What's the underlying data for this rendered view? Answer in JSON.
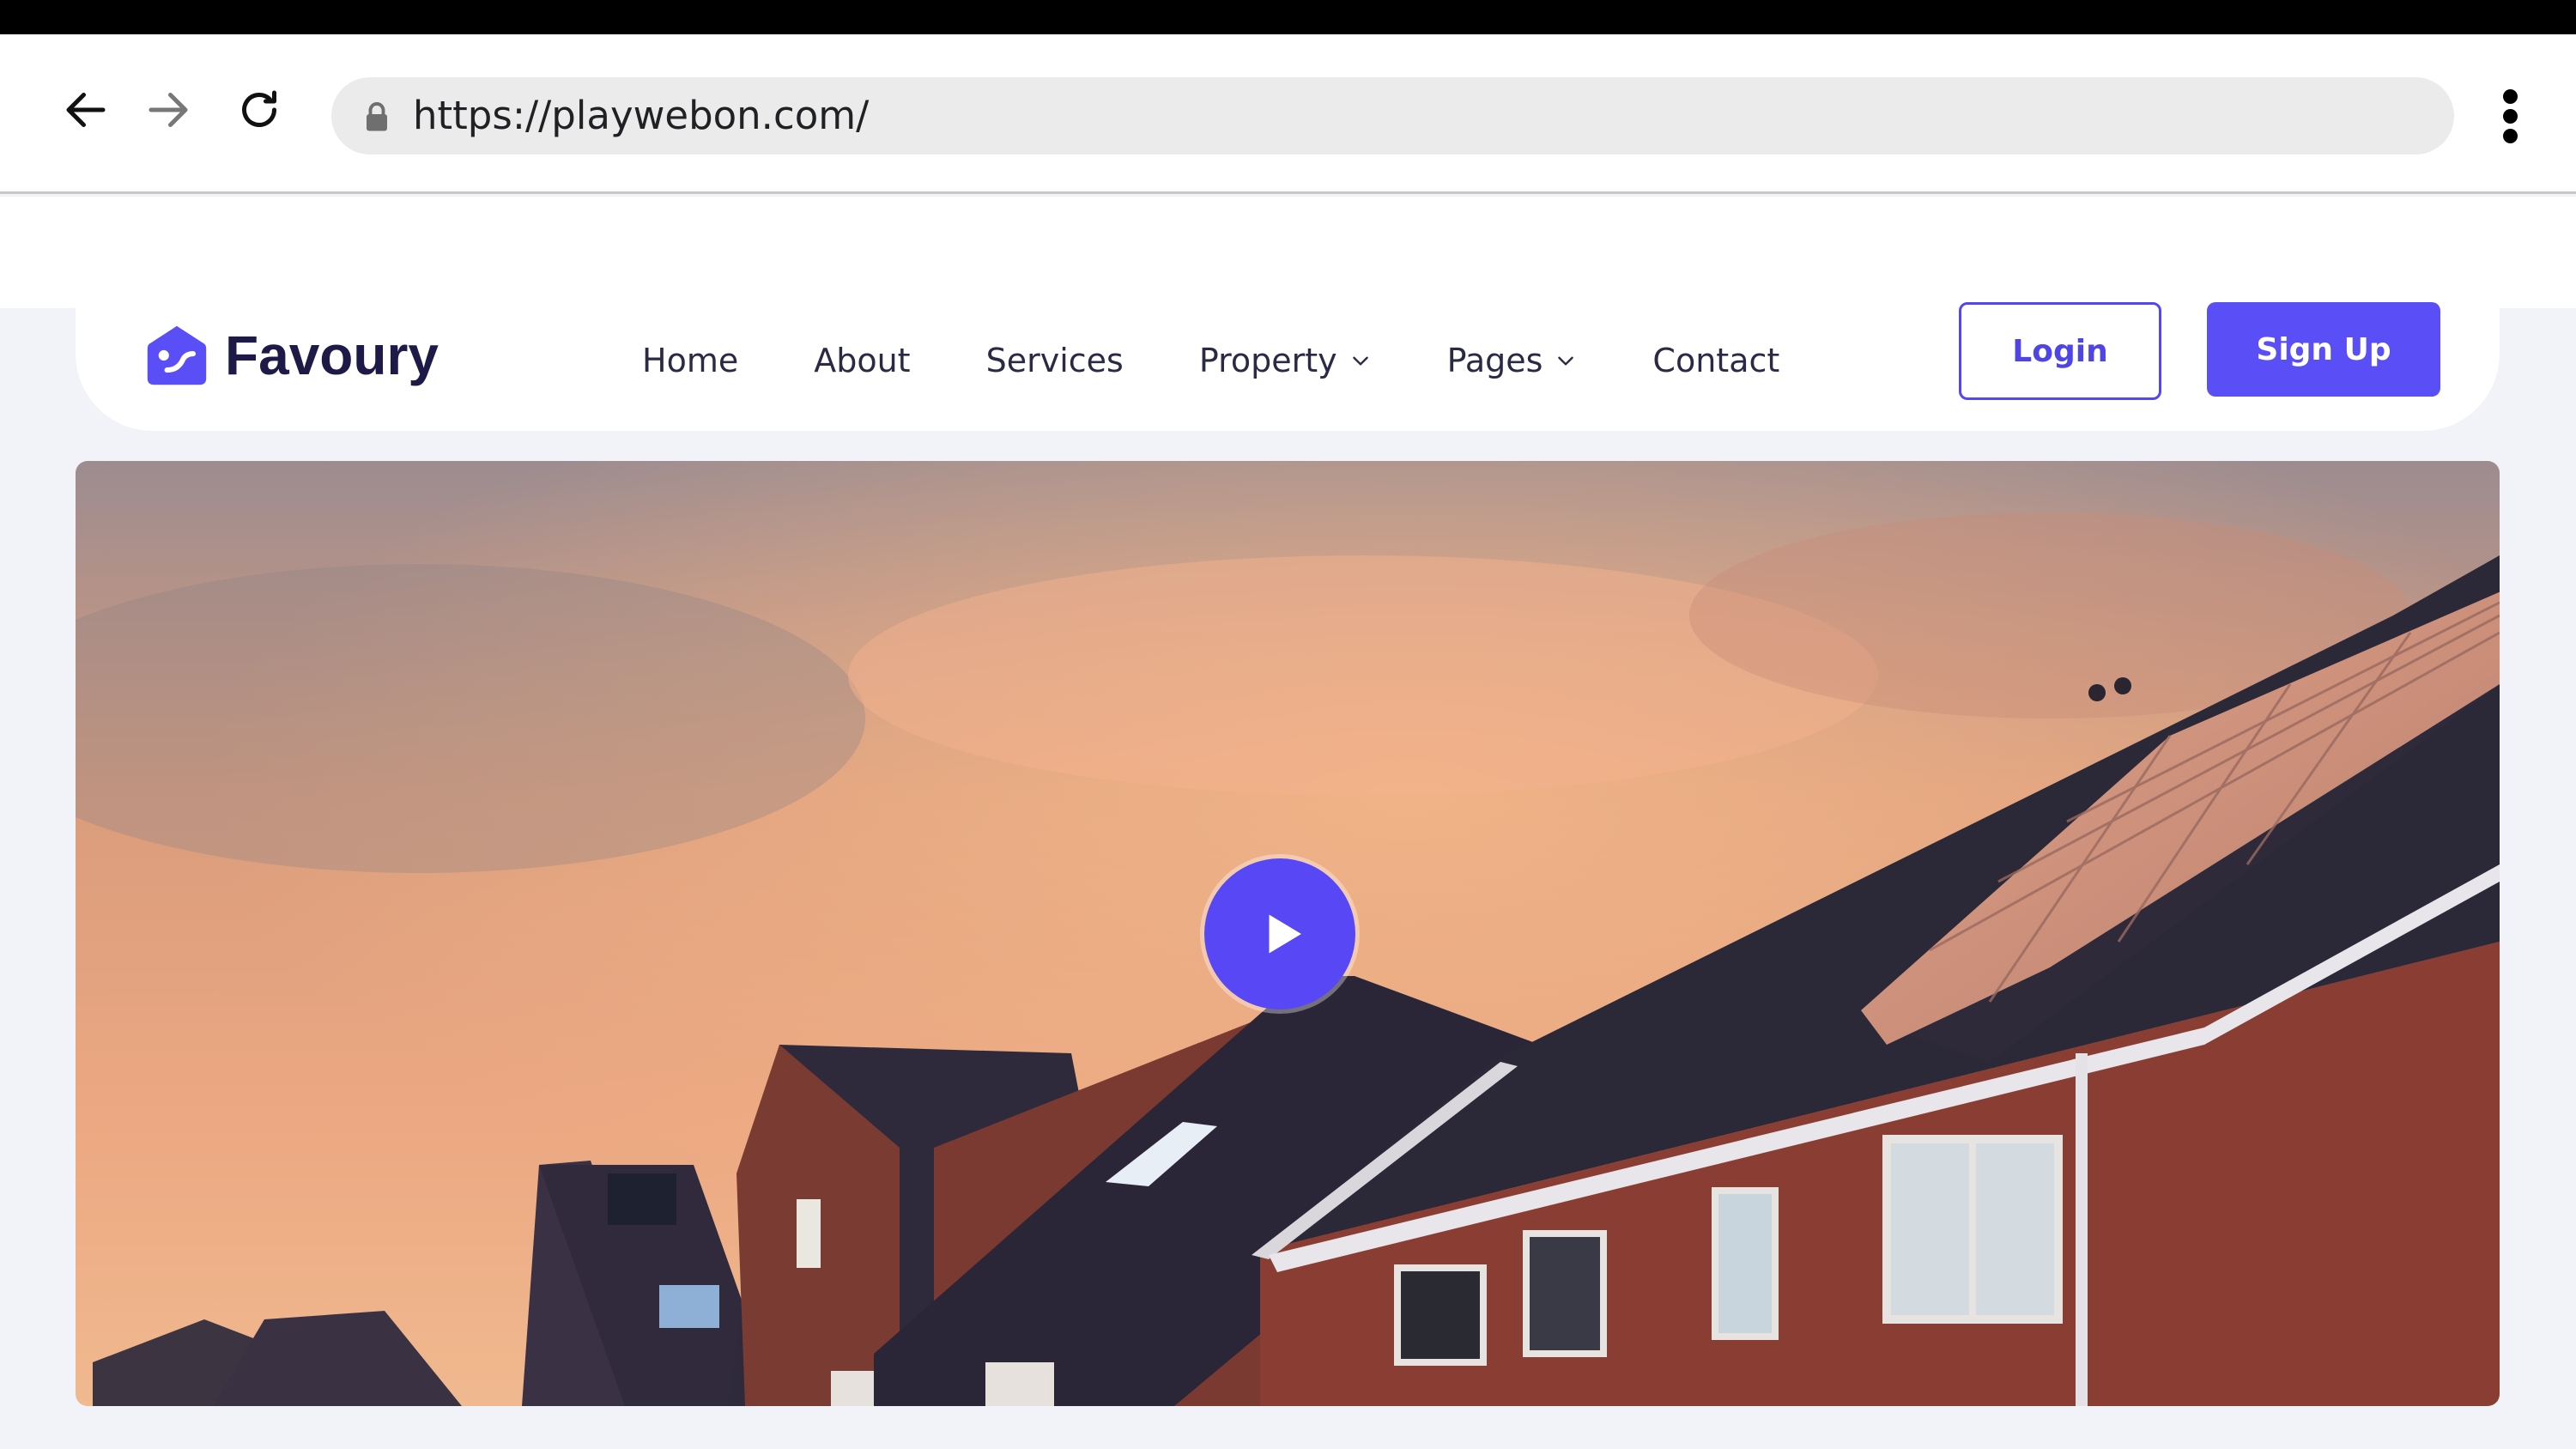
{
  "browser": {
    "url": "https://playwebon.com/",
    "back_icon": "arrow-left-icon",
    "forward_icon": "arrow-right-icon",
    "reload_icon": "reload-icon",
    "menu_icon": "more-vertical-icon",
    "lock_icon": "lock-icon"
  },
  "header": {
    "logo_text": "Favoury",
    "nav": [
      {
        "label": "Home"
      },
      {
        "label": "About"
      },
      {
        "label": "Services"
      },
      {
        "label": "Property",
        "icon": "chevron-down-icon"
      },
      {
        "label": "Pages",
        "icon": "chevron-down-icon"
      },
      {
        "label": "Contact"
      }
    ],
    "login_label": "Login",
    "signup_label": "Sign Up"
  },
  "hero": {
    "play_icon": "play-icon"
  },
  "colors": {
    "brand": "#5a4ef7",
    "brand_text": "#1d1a47",
    "page_bg": "#f2f2f9"
  }
}
